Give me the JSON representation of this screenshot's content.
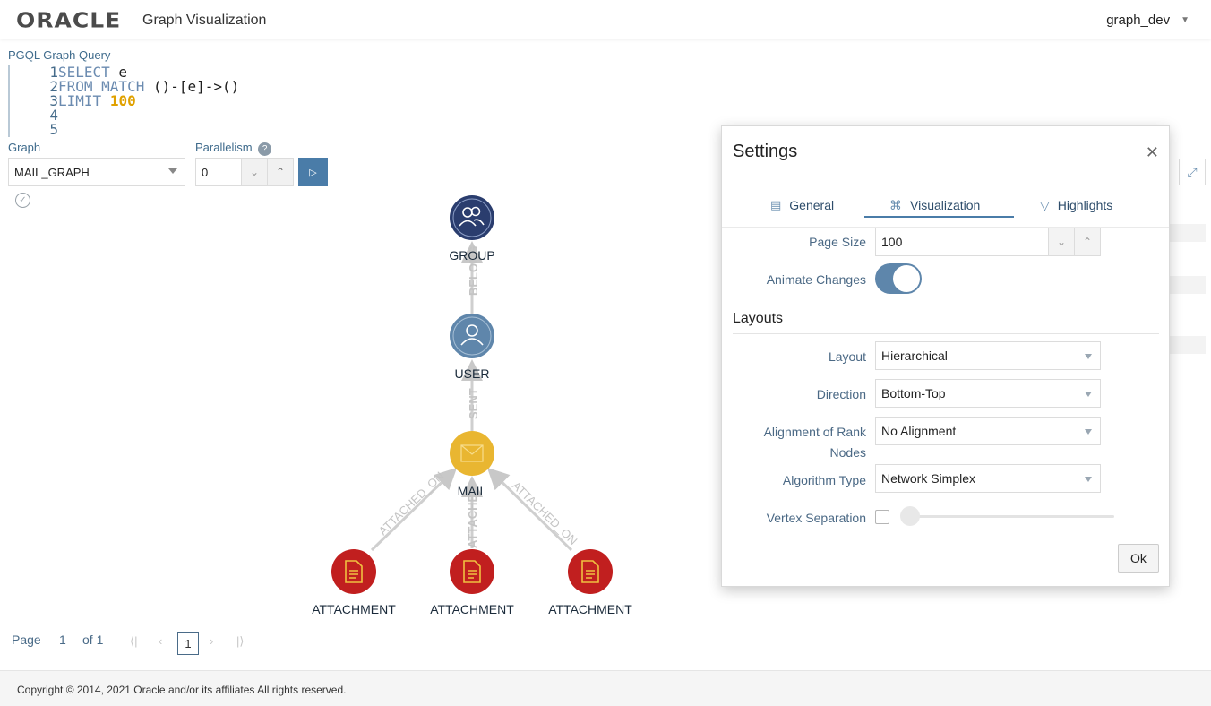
{
  "header": {
    "brand": "ORACLE",
    "app_title": "Graph Visualization",
    "user": "graph_dev"
  },
  "query": {
    "label": "PGQL Graph Query",
    "lines": [
      {
        "n": "1",
        "kw": "SELECT",
        "rest": " e",
        "num": ""
      },
      {
        "n": "2",
        "kw": "FROM MATCH",
        "rest": " ()-[e]->()",
        "num": ""
      },
      {
        "n": "3",
        "kw": "LIMIT",
        "rest": " ",
        "num": "100"
      },
      {
        "n": "4",
        "kw": "",
        "rest": "",
        "num": ""
      },
      {
        "n": "5",
        "kw": "",
        "rest": "",
        "num": ""
      }
    ]
  },
  "controls": {
    "graph_label": "Graph",
    "graph_value": "MAIL_GRAPH",
    "parallelism_label": "Parallelism",
    "parallelism_value": "0"
  },
  "graph": {
    "nodes": {
      "group": "GROUP",
      "user": "USER",
      "mail": "MAIL",
      "attachment": "ATTACHMENT"
    },
    "edges": {
      "belongs": "BELONG",
      "sent": "SENT",
      "attached_on": "ATTACHED_ON",
      "attached_short": "ATTACHE"
    }
  },
  "pager": {
    "page_label": "Page",
    "page_value": "1",
    "of_label": "of 1",
    "current": "1"
  },
  "footer": {
    "copyright": "Copyright © 2014, 2021 Oracle and/or its affiliates All rights reserved."
  },
  "settings": {
    "title": "Settings",
    "tabs": {
      "general": "General",
      "visualization": "Visualization",
      "highlights": "Highlights"
    },
    "page_size_label": "Page Size",
    "page_size_value": "100",
    "animate_label": "Animate Changes",
    "layouts_title": "Layouts",
    "layout_label": "Layout",
    "layout_value": "Hierarchical",
    "direction_label": "Direction",
    "direction_value": "Bottom-Top",
    "alignment_label_1": "Alignment of Rank",
    "alignment_label_2": "Nodes",
    "alignment_value": "No Alignment",
    "algorithm_label": "Algorithm Type",
    "algorithm_value": "Network Simplex",
    "vertex_sep_label": "Vertex Separation",
    "ok_label": "Ok"
  }
}
